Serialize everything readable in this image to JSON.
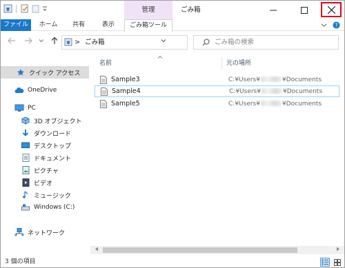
{
  "window": {
    "title": "ごみ箱",
    "context_tab_header": "管理"
  },
  "ribbon": {
    "tabs": [
      {
        "label": "ファイル"
      },
      {
        "label": "ホーム"
      },
      {
        "label": "共有"
      },
      {
        "label": "表示"
      },
      {
        "label": "ごみ箱ツール"
      }
    ]
  },
  "address_bar": {
    "path_separator": ">",
    "path": "ごみ箱",
    "search_placeholder": "ごみ箱の検索"
  },
  "nav_pane": {
    "items": [
      {
        "label": "クイック アクセス",
        "icon": "star-icon"
      },
      {
        "label": "OneDrive",
        "icon": "cloud-icon"
      },
      {
        "label": "PC",
        "icon": "pc-icon"
      },
      {
        "label": "3D オブジェクト",
        "icon": "3d-objects-icon"
      },
      {
        "label": "ダウンロード",
        "icon": "download-icon"
      },
      {
        "label": "デスクトップ",
        "icon": "desktop-icon"
      },
      {
        "label": "ドキュメント",
        "icon": "documents-icon"
      },
      {
        "label": "ピクチャ",
        "icon": "pictures-icon"
      },
      {
        "label": "ビデオ",
        "icon": "videos-icon"
      },
      {
        "label": "ミュージック",
        "icon": "music-icon"
      },
      {
        "label": "Windows (C:)",
        "icon": "drive-icon"
      },
      {
        "label": "ネットワーク",
        "icon": "network-icon"
      }
    ]
  },
  "file_list": {
    "columns": {
      "name": "名前",
      "location": "元の場所"
    },
    "rows": [
      {
        "name": "Sample3",
        "location_prefix": "C:¥Users¥",
        "location_suffix": "¥Documents"
      },
      {
        "name": "Sample4",
        "location_prefix": "C:¥Users¥",
        "location_suffix": "¥Documents"
      },
      {
        "name": "Sample5",
        "location_prefix": "C:¥Users¥",
        "location_suffix": "¥Documents"
      }
    ]
  },
  "status_bar": {
    "item_count": "3 個の項目"
  },
  "colors": {
    "file_tab_bg": "#1979ca",
    "manage_tab_bg": "#f1e3f7",
    "close_highlight": "#e3001b",
    "selection_border": "#99d1ff"
  }
}
